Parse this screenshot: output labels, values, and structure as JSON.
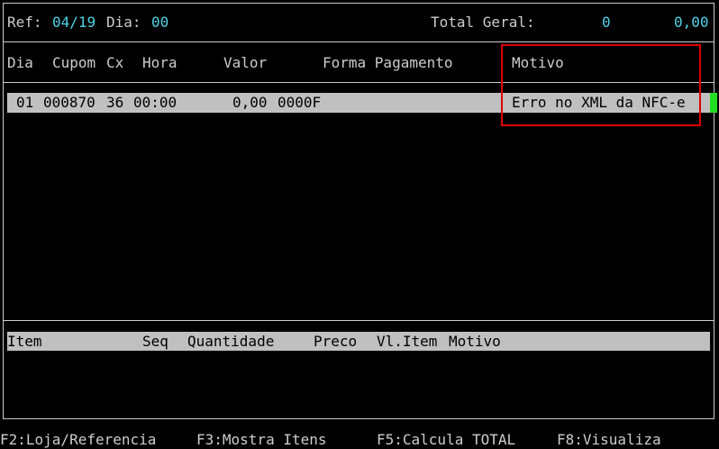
{
  "header": {
    "ref_label": "Ref:",
    "ref_value": "04/19",
    "dia_label": "Dia:",
    "dia_value": "00",
    "total_label": "Total Geral:",
    "total_count": "0",
    "total_value": "0,00"
  },
  "columns": {
    "dia": "Dia",
    "cupom": "Cupom",
    "cx": "Cx",
    "hora": "Hora",
    "valor": "Valor",
    "forma": "Forma Pagamento",
    "motivo": "Motivo"
  },
  "rows": [
    {
      "dia": "01",
      "cupom": "000870",
      "cx": "36",
      "hora": "00:00",
      "valor": "0,00",
      "forma": "0000F",
      "motivo": "Erro no XML da NFC-e"
    }
  ],
  "items_header": {
    "item": "Item",
    "seq": "Seq",
    "quantidade": "Quantidade",
    "preco": "Preco",
    "vl_item": "Vl.Item",
    "motivo": "Motivo"
  },
  "function_keys": [
    "F2:Loja/Referencia",
    "F3:Mostra Itens",
    "F5:Calcula TOTAL",
    "F8:Visualiza"
  ],
  "colors": {
    "accent_cyan": "#4fd3e6",
    "highlight_red": "#e00000",
    "cursor_green": "#22dd22",
    "selection_gray": "#c0c0c0"
  }
}
